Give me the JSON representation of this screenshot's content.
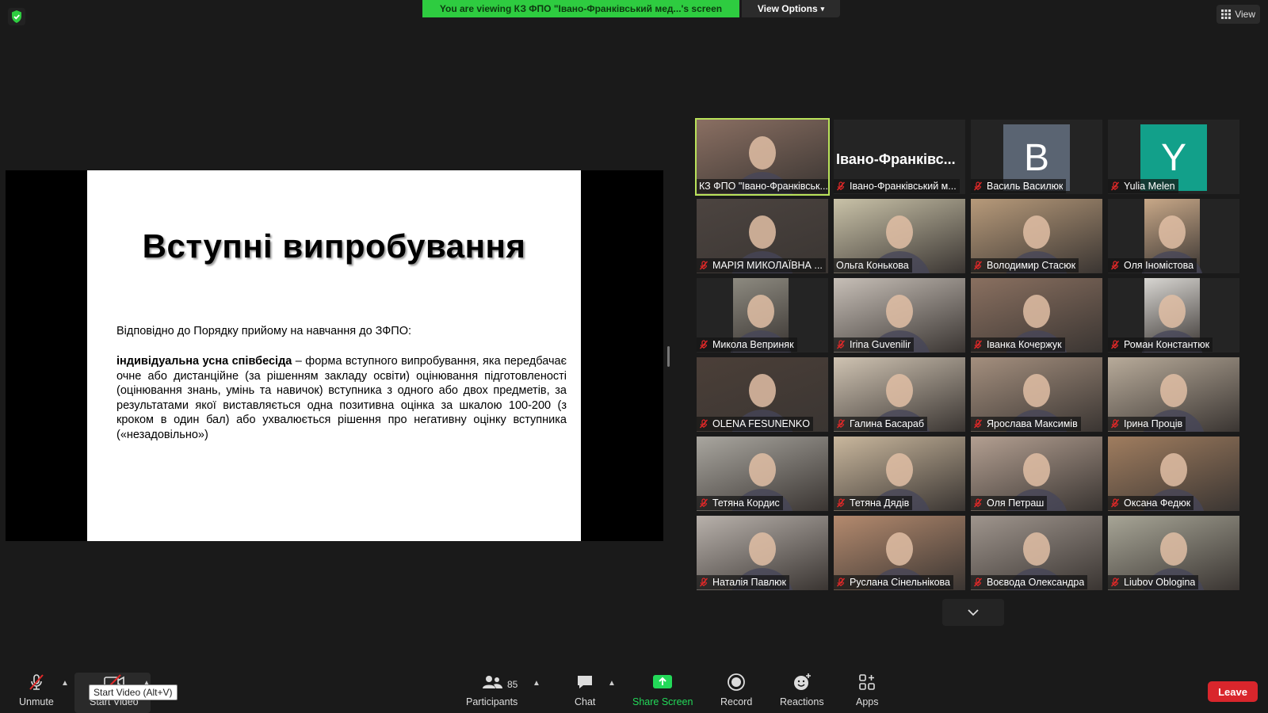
{
  "top": {
    "banner_text": "You are viewing КЗ ФПО \"Івано-Франківський мед...'s screen",
    "view_options_label": "View Options",
    "view_label": "View"
  },
  "slide": {
    "title": "Вступні випробування",
    "intro": "Відповідно до Порядку прийому на навчання до ЗФПО:",
    "term": "індивідуальна усна співбесіда",
    "body": " – форма вступного випробування, яка передбачає очне або дистанційне (за рішенням закладу освіти) оцінювання підготовленості (оцінювання знань, умінь та навичок) вступника з одного або двох предметів, за результатами якої виставляється одна позитивна оцінка за шкалою 100-200 (з кроком в один бал) або ухвалюється рішення про негативну оцінку вступника («незадовільно»)"
  },
  "participants": [
    {
      "name": "КЗ ФПО \"Івано-Франківськ...",
      "muted": false,
      "kind": "video",
      "bg": "#8a6f62",
      "active": true
    },
    {
      "name": "Івано-Франківський м...",
      "muted": true,
      "kind": "text",
      "display": "Івано-Франківс..."
    },
    {
      "name": "Василь Василюк",
      "muted": true,
      "kind": "letter",
      "letter": "B",
      "color": "#5a6472"
    },
    {
      "name": "Yulia Melen",
      "muted": true,
      "kind": "letter",
      "letter": "Y",
      "color": "#12a08a"
    },
    {
      "name": "МАРІЯ МИКОЛАЇВНА ...",
      "muted": true,
      "kind": "video",
      "bg": "#4c4440"
    },
    {
      "name": "Ольга Конькова",
      "muted": false,
      "kind": "video",
      "bg": "#c9c2a8"
    },
    {
      "name": "Володимир Стасюк",
      "muted": true,
      "kind": "video",
      "bg": "#b79a7a"
    },
    {
      "name": "Оля Іномістова",
      "muted": true,
      "kind": "video",
      "bg": "#c8a888",
      "narrow": true
    },
    {
      "name": "Микола Веприняк",
      "muted": true,
      "kind": "video",
      "bg": "#8d8a80",
      "narrow": true
    },
    {
      "name": "Irina Guvenilir",
      "muted": true,
      "kind": "video",
      "bg": "#c7bfb7"
    },
    {
      "name": "Іванка Кочержук",
      "muted": true,
      "kind": "video",
      "bg": "#8a7060"
    },
    {
      "name": "Роман Константюк",
      "muted": true,
      "kind": "video",
      "bg": "#d8d6d2",
      "narrow": true
    },
    {
      "name": "OLENA FESUNENKO",
      "muted": true,
      "kind": "video",
      "bg": "#4b3f38"
    },
    {
      "name": "Галина Басараб",
      "muted": true,
      "kind": "video",
      "bg": "#cfc3b2"
    },
    {
      "name": "Ярослава Максимів",
      "muted": true,
      "kind": "video",
      "bg": "#a48f7e"
    },
    {
      "name": "Ірина Проців",
      "muted": true,
      "kind": "video",
      "bg": "#b8ab9a"
    },
    {
      "name": "Тетяна Кордис",
      "muted": true,
      "kind": "video",
      "bg": "#a9a69f"
    },
    {
      "name": "Тетяна Дядів",
      "muted": true,
      "kind": "video",
      "bg": "#c9b79d"
    },
    {
      "name": "Оля Петраш",
      "muted": true,
      "kind": "video",
      "bg": "#b39f91"
    },
    {
      "name": "Оксана Федюк",
      "muted": true,
      "kind": "video",
      "bg": "#a07d5f"
    },
    {
      "name": "Наталія Павлюк",
      "muted": true,
      "kind": "video",
      "bg": "#b8b1ab"
    },
    {
      "name": "Руслана Сінельнікова",
      "muted": true,
      "kind": "video",
      "bg": "#b48a6e"
    },
    {
      "name": "Воєвода Олександра",
      "muted": true,
      "kind": "video",
      "bg": "#9f958d"
    },
    {
      "name": "Liubov Oblogina",
      "muted": true,
      "kind": "video",
      "bg": "#a7a596"
    }
  ],
  "toolbar": {
    "unmute_label": "Unmute",
    "start_video_label": "Start Video",
    "tooltip": "Start Video (Alt+V)",
    "participants_label": "Participants",
    "participants_count": "85",
    "chat_label": "Chat",
    "share_label": "Share Screen",
    "record_label": "Record",
    "reactions_label": "Reactions",
    "apps_label": "Apps",
    "leave_label": "Leave"
  },
  "colors": {
    "banner_green": "#2ecc40",
    "share_green": "#23d959",
    "leave_red": "#d9262c",
    "active_speaker": "#b9e25a",
    "muted_red": "#e02828"
  }
}
